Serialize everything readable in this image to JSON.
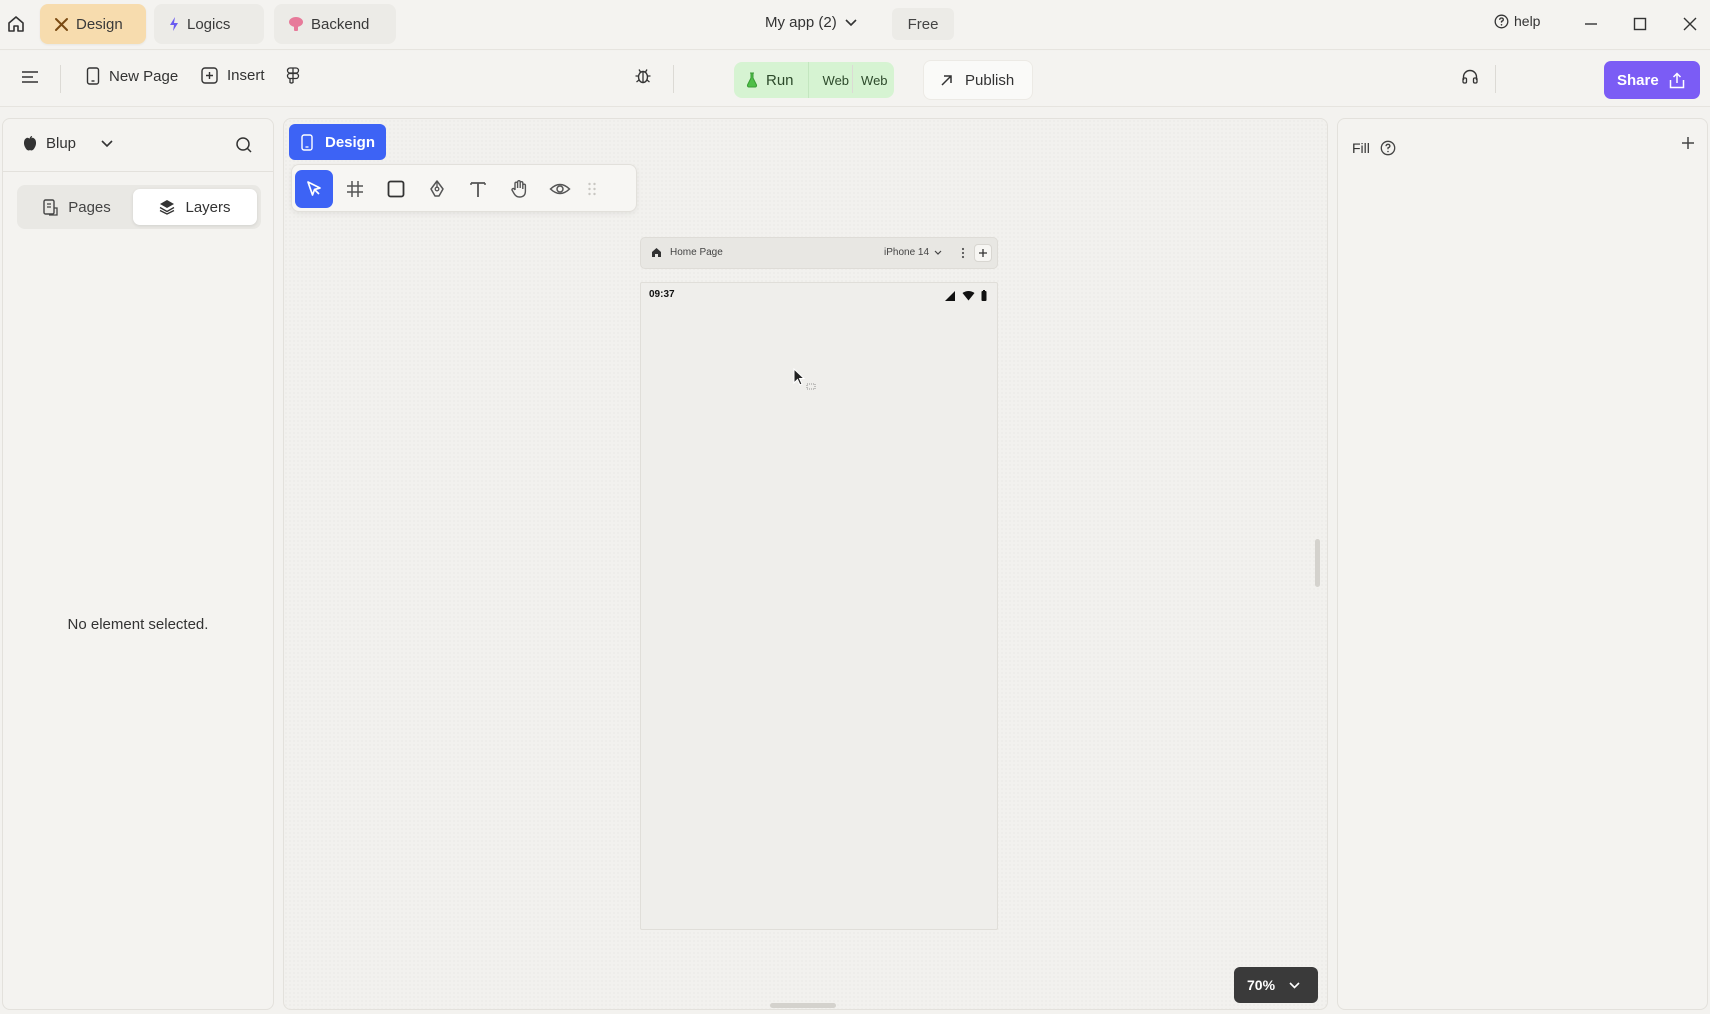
{
  "titlebar": {
    "tabs": [
      {
        "label": "Design"
      },
      {
        "label": "Logics"
      },
      {
        "label": "Backend"
      }
    ],
    "app_name": "My app (2)",
    "plan": "Free",
    "help_label": "help"
  },
  "toolbar": {
    "new_page_label": "New Page",
    "insert_label": "Insert",
    "run_label": "Run",
    "run_targets": [
      "Web",
      "Web"
    ],
    "publish_label": "Publish",
    "share_label": "Share"
  },
  "left_panel": {
    "project_name": "Blup",
    "tabs": [
      {
        "label": "Pages"
      },
      {
        "label": "Layers"
      }
    ],
    "active_tab": "Layers",
    "empty_message": "No element selected."
  },
  "canvas": {
    "mode_label": "Design",
    "tools": [
      "select-icon",
      "frame-grid-icon",
      "rectangle-icon",
      "pen-icon",
      "text-icon",
      "hand-icon",
      "preview-eye-icon"
    ],
    "frame": {
      "page_name": "Home Page",
      "device": "iPhone 14",
      "status_time": "09:37"
    },
    "zoom": "70%"
  },
  "right_panel": {
    "fill_label": "Fill"
  },
  "colors": {
    "accent_blue": "#3d63f5",
    "share_purple": "#7b5cf5",
    "run_green": "#d6f3d2",
    "design_tab": "#f7dcae"
  }
}
